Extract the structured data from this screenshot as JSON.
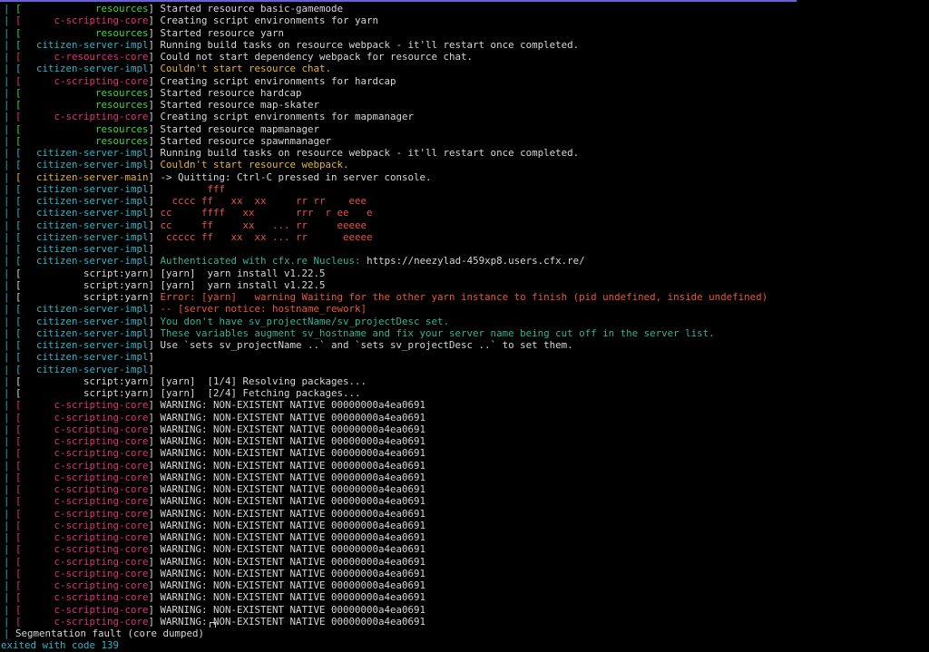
{
  "colors": {
    "bar": "#00b9b9",
    "white": "#d6d6d6",
    "green": "#3fd83f",
    "magenta": "#e0307a",
    "cyan": "#2ab8c8",
    "yellow": "#e6b432",
    "red": "#e8524a",
    "teal_msg": "#2fb49a",
    "orange_red": "#e8563a",
    "accent_bar": "#6b5fd8"
  },
  "lines": [
    {
      "src": "resources",
      "srcColor": "green",
      "msg": "Started resource basic-gamemode",
      "msgColor": "white"
    },
    {
      "src": "c-scripting-core",
      "srcColor": "magenta",
      "msg": "Creating script environments for yarn",
      "msgColor": "white"
    },
    {
      "src": "resources",
      "srcColor": "green",
      "msg": "Started resource yarn",
      "msgColor": "white"
    },
    {
      "src": "citizen-server-impl",
      "srcColor": "cyan",
      "msg": "Running build tasks on resource webpack - it'll restart once completed.",
      "msgColor": "white"
    },
    {
      "src": "c-resources-core",
      "srcColor": "magenta",
      "msg": "Could not start dependency webpack for resource chat.",
      "msgColor": "white"
    },
    {
      "src": "citizen-server-impl",
      "srcColor": "cyan",
      "msg": "Couldn't start resource chat.",
      "msgColor": "yellow"
    },
    {
      "src": "c-scripting-core",
      "srcColor": "magenta",
      "msg": "Creating script environments for hardcap",
      "msgColor": "white"
    },
    {
      "src": "resources",
      "srcColor": "green",
      "msg": "Started resource hardcap",
      "msgColor": "white"
    },
    {
      "src": "resources",
      "srcColor": "green",
      "msg": "Started resource map-skater",
      "msgColor": "white"
    },
    {
      "src": "c-scripting-core",
      "srcColor": "magenta",
      "msg": "Creating script environments for mapmanager",
      "msgColor": "white"
    },
    {
      "src": "resources",
      "srcColor": "green",
      "msg": "Started resource mapmanager",
      "msgColor": "white"
    },
    {
      "src": "resources",
      "srcColor": "green",
      "msg": "Started resource spawnmanager",
      "msgColor": "white"
    },
    {
      "src": "citizen-server-impl",
      "srcColor": "cyan",
      "msg": "Running build tasks on resource webpack - it'll restart once completed.",
      "msgColor": "white"
    },
    {
      "src": "citizen-server-impl",
      "srcColor": "cyan",
      "msg": "Couldn't start resource webpack.",
      "msgColor": "yellow"
    },
    {
      "src": "citizen-server-main",
      "srcColor": "yellow",
      "msg": "-> Quitting: Ctrl-C pressed in server console.",
      "msgColor": "white"
    },
    {
      "src": "citizen-server-impl",
      "srcColor": "cyan",
      "msg": "        fff",
      "msgColor": "red"
    },
    {
      "src": "citizen-server-impl",
      "srcColor": "cyan",
      "msg": "  cccc ff   xx  xx     rr rr    eee",
      "msgColor": "red"
    },
    {
      "src": "citizen-server-impl",
      "srcColor": "cyan",
      "msg": "cc     ffff   xx       rrr  r ee   e",
      "msgColor": "red"
    },
    {
      "src": "citizen-server-impl",
      "srcColor": "cyan",
      "msg": "cc     ff     xx   ... rr     eeeee",
      "msgColor": "red"
    },
    {
      "src": "citizen-server-impl",
      "srcColor": "cyan",
      "msg": " ccccc ff   xx  xx ... rr      eeeee",
      "msgColor": "red"
    },
    {
      "src": "citizen-server-impl",
      "srcColor": "cyan",
      "msg": "",
      "msgColor": "white"
    },
    {
      "src": "citizen-server-impl",
      "srcColor": "cyan",
      "msg": "Authenticated with cfx.re Nucleus: ",
      "msgColor": "teal_msg",
      "msg2": "https://neezylad-459xp8.users.cfx.re/",
      "msg2Color": "white"
    },
    {
      "src": "script:yarn",
      "srcColor": "white",
      "msg": "[yarn]  yarn install v1.22.5",
      "msgColor": "white"
    },
    {
      "src": "script:yarn",
      "srcColor": "white",
      "msg": "[yarn]  yarn install v1.22.5",
      "msgColor": "white"
    },
    {
      "src": "script:yarn",
      "srcColor": "white",
      "msg": "Error: [yarn]   warning Waiting for the other yarn instance to finish (pid undefined, inside undefined)",
      "msgColor": "orange_red"
    },
    {
      "src": "citizen-server-impl",
      "srcColor": "cyan",
      "msg": "-- [server notice: hostname_rework]",
      "msgColor": "orange_red"
    },
    {
      "src": "citizen-server-impl",
      "srcColor": "cyan",
      "msg": "You don't have sv_projectName/sv_projectDesc set.",
      "msgColor": "teal_msg"
    },
    {
      "src": "citizen-server-impl",
      "srcColor": "cyan",
      "msg": "These variables augment sv_hostname and fix your server name being cut off in the server list.",
      "msgColor": "teal_msg"
    },
    {
      "src": "citizen-server-impl",
      "srcColor": "cyan",
      "msg": "Use `sets sv_projectName ..` and `sets sv_projectDesc ..` to set them.",
      "msgColor": "white"
    },
    {
      "src": "citizen-server-impl",
      "srcColor": "cyan",
      "msg": "",
      "msgColor": "white"
    },
    {
      "src": "citizen-server-impl",
      "srcColor": "cyan",
      "msg": "",
      "msgColor": "white"
    },
    {
      "src": "script:yarn",
      "srcColor": "white",
      "msg": "[yarn]  [1/4] Resolving packages...",
      "msgColor": "white"
    },
    {
      "src": "script:yarn",
      "srcColor": "white",
      "msg": "[yarn]  [2/4] Fetching packages...",
      "msgColor": "white"
    },
    {
      "src": "c-scripting-core",
      "srcColor": "magenta",
      "msg": "WARNING: NON-EXISTENT NATIVE 00000000a4ea0691",
      "msgColor": "white"
    },
    {
      "src": "c-scripting-core",
      "srcColor": "magenta",
      "msg": "WARNING: NON-EXISTENT NATIVE 00000000a4ea0691",
      "msgColor": "white"
    },
    {
      "src": "c-scripting-core",
      "srcColor": "magenta",
      "msg": "WARNING: NON-EXISTENT NATIVE 00000000a4ea0691",
      "msgColor": "white"
    },
    {
      "src": "c-scripting-core",
      "srcColor": "magenta",
      "msg": "WARNING: NON-EXISTENT NATIVE 00000000a4ea0691",
      "msgColor": "white"
    },
    {
      "src": "c-scripting-core",
      "srcColor": "magenta",
      "msg": "WARNING: NON-EXISTENT NATIVE 00000000a4ea0691",
      "msgColor": "white"
    },
    {
      "src": "c-scripting-core",
      "srcColor": "magenta",
      "msg": "WARNING: NON-EXISTENT NATIVE 00000000a4ea0691",
      "msgColor": "white"
    },
    {
      "src": "c-scripting-core",
      "srcColor": "magenta",
      "msg": "WARNING: NON-EXISTENT NATIVE 00000000a4ea0691",
      "msgColor": "white"
    },
    {
      "src": "c-scripting-core",
      "srcColor": "magenta",
      "msg": "WARNING: NON-EXISTENT NATIVE 00000000a4ea0691",
      "msgColor": "white"
    },
    {
      "src": "c-scripting-core",
      "srcColor": "magenta",
      "msg": "WARNING: NON-EXISTENT NATIVE 00000000a4ea0691",
      "msgColor": "white"
    },
    {
      "src": "c-scripting-core",
      "srcColor": "magenta",
      "msg": "WARNING: NON-EXISTENT NATIVE 00000000a4ea0691",
      "msgColor": "white"
    },
    {
      "src": "c-scripting-core",
      "srcColor": "magenta",
      "msg": "WARNING: NON-EXISTENT NATIVE 00000000a4ea0691",
      "msgColor": "white"
    },
    {
      "src": "c-scripting-core",
      "srcColor": "magenta",
      "msg": "WARNING: NON-EXISTENT NATIVE 00000000a4ea0691",
      "msgColor": "white"
    },
    {
      "src": "c-scripting-core",
      "srcColor": "magenta",
      "msg": "WARNING: NON-EXISTENT NATIVE 00000000a4ea0691",
      "msgColor": "white"
    },
    {
      "src": "c-scripting-core",
      "srcColor": "magenta",
      "msg": "WARNING: NON-EXISTENT NATIVE 00000000a4ea0691",
      "msgColor": "white"
    },
    {
      "src": "c-scripting-core",
      "srcColor": "magenta",
      "msg": "WARNING: NON-EXISTENT NATIVE 00000000a4ea0691",
      "msgColor": "white"
    },
    {
      "src": "c-scripting-core",
      "srcColor": "magenta",
      "msg": "WARNING: NON-EXISTENT NATIVE 00000000a4ea0691",
      "msgColor": "white"
    },
    {
      "src": "c-scripting-core",
      "srcColor": "magenta",
      "msg": "WARNING: NON-EXISTENT NATIVE 00000000a4ea0691",
      "msgColor": "white"
    },
    {
      "src": "c-scripting-core",
      "srcColor": "magenta",
      "msg": "WARNING: NON-EXISTENT NATIVE 00000000a4ea0691",
      "msgColor": "white"
    },
    {
      "src": "c-scripting-core",
      "srcColor": "magenta",
      "msg": "WARNING: NON-EXISTENT NATIVE 00000000a4ea0691",
      "msgColor": "white"
    }
  ],
  "footer": {
    "segfault": "Segmentation fault (core dumped)",
    "exit": "exited with code 139"
  }
}
